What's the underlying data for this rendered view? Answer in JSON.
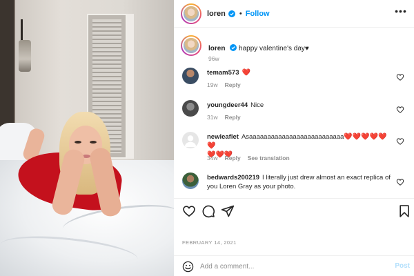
{
  "header": {
    "username": "loren",
    "separator": "•",
    "follow_label": "Follow",
    "more_label": "•••"
  },
  "caption": {
    "username": "loren",
    "text": "happy valentine's day",
    "heart": "♥",
    "time": "96w"
  },
  "comments": [
    {
      "username": "temam573",
      "text": "",
      "emoji": "❤️",
      "time": "19w",
      "reply_label": "Reply"
    },
    {
      "username": "youngdeer44",
      "text": "Nice",
      "time": "31w",
      "reply_label": "Reply"
    },
    {
      "username": "newleaflet",
      "text": "Asaaaaaaaaaaaaaaaaaaaaaaaaaa",
      "emoji_line1": "❤️❤️❤️❤️❤️❤️",
      "emoji_line2": "❤️❤️❤️",
      "time": "34w",
      "reply_label": "Reply",
      "translate_label": "See translation"
    },
    {
      "username": "bedwards200219",
      "text": "I literally just drew almost an exact replica of you Loren Gray as your photo.",
      "time": "",
      "reply_label": ""
    }
  ],
  "actions": {
    "like_icon": "heart-outline-icon",
    "comment_icon": "comment-bubble-icon",
    "share_icon": "paper-plane-icon",
    "save_icon": "bookmark-icon"
  },
  "date": "FEBRUARY 14, 2021",
  "composer": {
    "placeholder": "Add a comment...",
    "post_label": "Post"
  },
  "colors": {
    "link_blue": "#0095f6",
    "secondary_text": "#8e8e8e",
    "heart_red": "#e0112b",
    "post_disabled": "#b2dffc"
  }
}
